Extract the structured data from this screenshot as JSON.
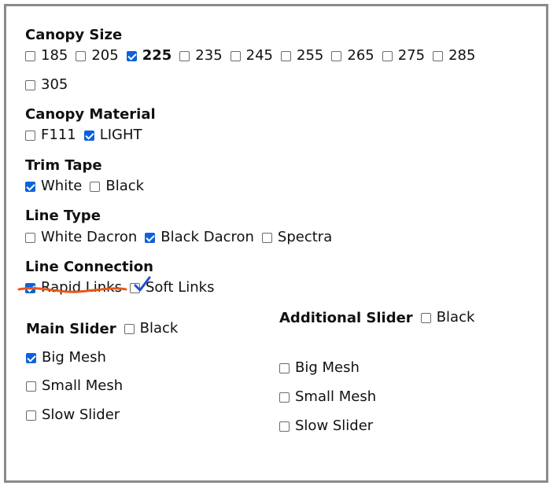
{
  "canopy_size": {
    "heading": "Canopy Size",
    "options": [
      {
        "label": "185",
        "checked": false
      },
      {
        "label": "205",
        "checked": false
      },
      {
        "label": "225",
        "checked": true
      },
      {
        "label": "235",
        "checked": false
      },
      {
        "label": "245",
        "checked": false
      },
      {
        "label": "255",
        "checked": false
      },
      {
        "label": "265",
        "checked": false
      },
      {
        "label": "275",
        "checked": false
      },
      {
        "label": "285",
        "checked": false
      },
      {
        "label": "305",
        "checked": false
      }
    ]
  },
  "canopy_material": {
    "heading": "Canopy Material",
    "options": [
      {
        "label": "F111",
        "checked": false
      },
      {
        "label": "LIGHT",
        "checked": true
      }
    ]
  },
  "trim_tape": {
    "heading": "Trim Tape",
    "options": [
      {
        "label": "White",
        "checked": true
      },
      {
        "label": "Black",
        "checked": false
      }
    ]
  },
  "line_type": {
    "heading": "Line Type",
    "options": [
      {
        "label": "White Dacron",
        "checked": false
      },
      {
        "label": "Black Dacron",
        "checked": true
      },
      {
        "label": "Spectra",
        "checked": false
      }
    ]
  },
  "line_connection": {
    "heading": "Line Connection",
    "options": [
      {
        "label": "Rapid Links",
        "checked": true
      },
      {
        "label": "Soft Links",
        "checked": true
      }
    ]
  },
  "main_slider": {
    "heading": "Main Slider",
    "black": {
      "label": "Black",
      "checked": false
    },
    "options": [
      {
        "label": "Big Mesh",
        "checked": true
      },
      {
        "label": "Small Mesh",
        "checked": false
      },
      {
        "label": "Slow Slider",
        "checked": false
      }
    ]
  },
  "additional_slider": {
    "heading": "Additional Slider",
    "black": {
      "label": "Black",
      "checked": false
    },
    "options": [
      {
        "label": "Big Mesh",
        "checked": false
      },
      {
        "label": "Small Mesh",
        "checked": false
      },
      {
        "label": "Slow Slider",
        "checked": false
      }
    ]
  },
  "colors": {
    "checkbox_checked": "#0b63d9",
    "frame_border": "#8a8a8a",
    "strike_annotation": "#e8581c",
    "check_annotation": "#1f4fd6"
  }
}
